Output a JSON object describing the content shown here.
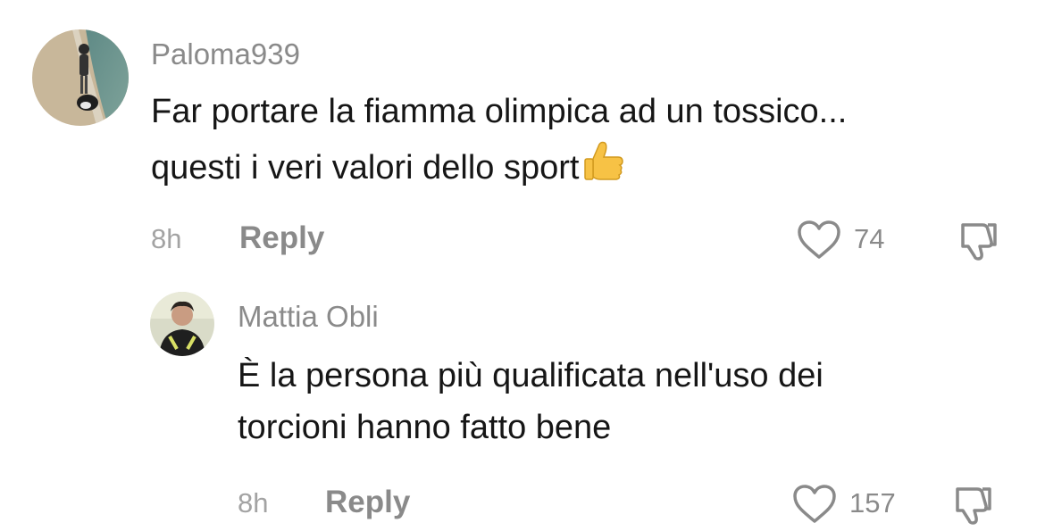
{
  "comments": [
    {
      "username": "Paloma939",
      "text_line1": "Far portare la fiamma olimpica ad un tossico...",
      "text_line2": "questi i veri valori dello sport",
      "emoji": "thumbs-up-emoji",
      "time": "8h",
      "reply_label": "Reply",
      "likes": "74",
      "avatar_icon": "avatar-beach-photo"
    },
    {
      "username": "Mattia Obli",
      "text_line1": "È la persona più qualificata nell'uso dei",
      "text_line2": "torcioni hanno fatto bene",
      "time": "8h",
      "reply_label": "Reply",
      "likes": "157",
      "avatar_icon": "avatar-person-photo"
    }
  ],
  "icons": {
    "like": "heart-icon",
    "dislike": "thumbs-down-icon"
  },
  "colors": {
    "text": "#161616",
    "muted": "#8a8a8a",
    "time": "#a3a3a3",
    "emoji": "#f7c245"
  }
}
